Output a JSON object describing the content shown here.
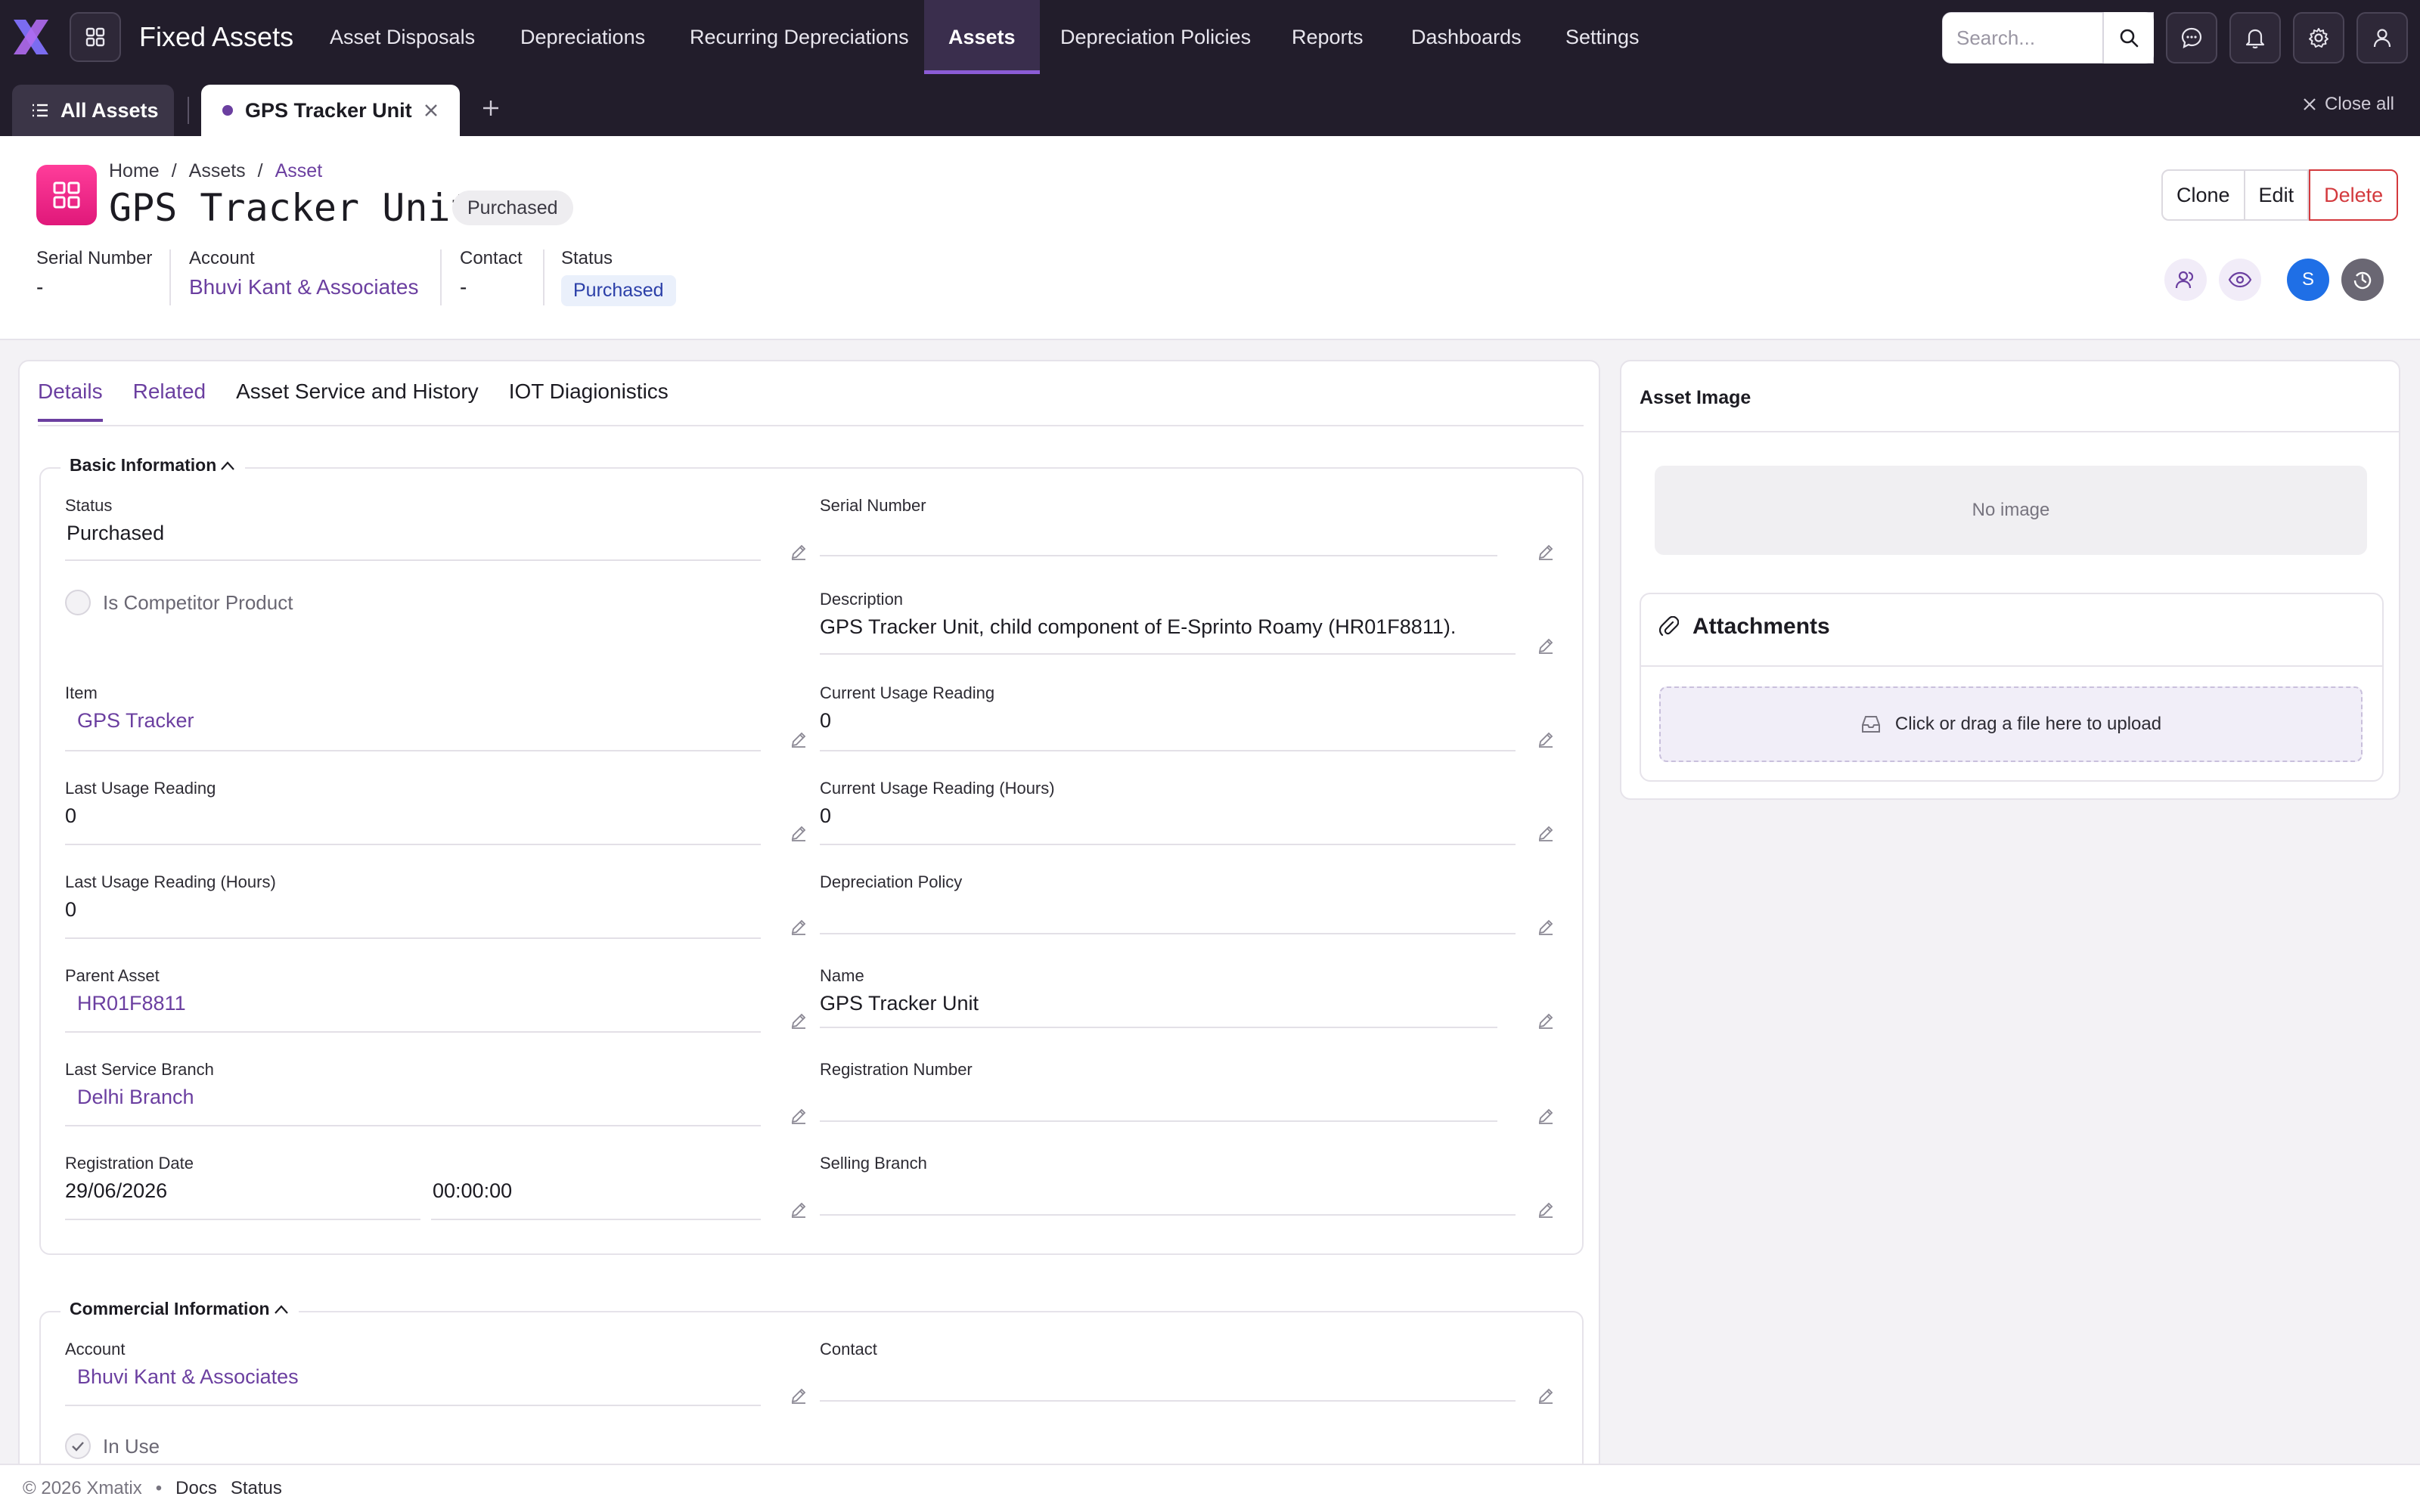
{
  "app": {
    "title": "Fixed Assets",
    "nav": [
      "Asset Disposals",
      "Depreciations",
      "Recurring Depreciations",
      "Assets",
      "Depreciation Policies",
      "Reports",
      "Dashboards",
      "Settings"
    ],
    "active_nav": "Assets",
    "search_placeholder": "Search...",
    "accent": "#6b3fa0"
  },
  "tabs": {
    "all_assets": "All Assets",
    "open_tab": "GPS Tracker Unit",
    "close_all": "Close all"
  },
  "header": {
    "breadcrumb": [
      "Home",
      "Assets",
      "Asset"
    ],
    "title": "GPS Tracker Unit",
    "status_badge": "Purchased",
    "buttons": {
      "clone": "Clone",
      "edit": "Edit",
      "delete": "Delete"
    },
    "summary": {
      "serial_label": "Serial Number",
      "serial_value": "-",
      "account_label": "Account",
      "account_value": "Bhuvi Kant & Associates",
      "contact_label": "Contact",
      "contact_value": "-",
      "status_label": "Status",
      "status_value": "Purchased"
    },
    "avatar_initial": "S"
  },
  "detail_tabs": [
    "Details",
    "Related",
    "Asset Service and History",
    "IOT Diagionistics"
  ],
  "basic": {
    "title": "Basic Information",
    "status_label": "Status",
    "status_value": "Purchased",
    "serial_label": "Serial Number",
    "serial_value": "",
    "competitor_label": "Is Competitor Product",
    "description_label": "Description",
    "description_value": "GPS Tracker Unit, child component of E-Sprinto Roamy (HR01F8811).",
    "item_label": "Item",
    "item_value": "GPS Tracker",
    "cur_usage_label": "Current Usage Reading",
    "cur_usage_value": "0",
    "last_usage_label": "Last Usage Reading",
    "last_usage_value": "0",
    "cur_usage_hours_label": "Current Usage Reading (Hours)",
    "cur_usage_hours_value": "0",
    "last_usage_hours_label": "Last Usage Reading (Hours)",
    "last_usage_hours_value": "0",
    "dep_policy_label": "Depreciation Policy",
    "dep_policy_value": "",
    "parent_label": "Parent Asset",
    "parent_value": "HR01F8811",
    "name_label": "Name",
    "name_value": "GPS Tracker Unit",
    "branch_label": "Last Service Branch",
    "branch_value": "Delhi Branch",
    "reg_no_label": "Registration Number",
    "reg_no_value": "",
    "reg_date_label": "Registration Date",
    "reg_date_value": "29/06/2026",
    "reg_time_value": "00:00:00",
    "selling_branch_label": "Selling Branch",
    "selling_branch_value": ""
  },
  "commercial": {
    "title": "Commercial Information",
    "account_label": "Account",
    "account_value": "Bhuvi Kant & Associates",
    "contact_label": "Contact",
    "contact_value": "",
    "in_use_label": "In Use"
  },
  "right": {
    "image_title": "Asset Image",
    "no_image": "No image",
    "attachments_title": "Attachments",
    "upload_text": "Click or drag a file here to upload"
  },
  "footer": {
    "copyright": "© 2026 Xmatix",
    "links": [
      "Docs",
      "Status"
    ]
  }
}
